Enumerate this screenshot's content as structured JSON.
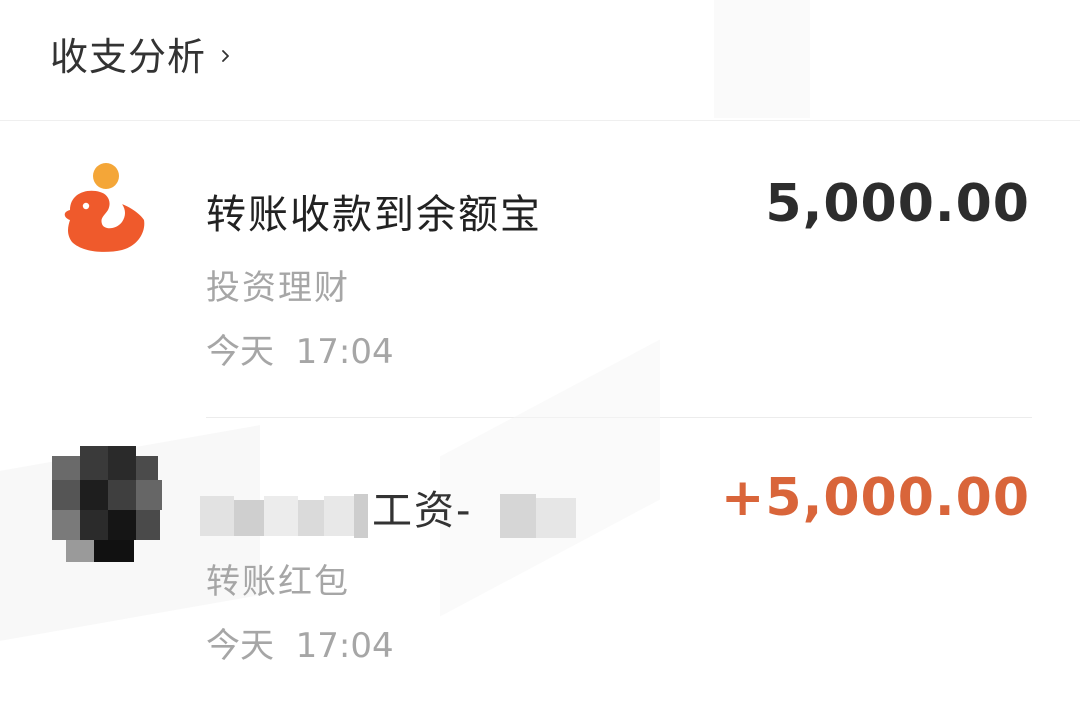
{
  "header": {
    "title": "收支分析",
    "chevron_icon": "chevron-right-icon"
  },
  "transactions": [
    {
      "icon": "yuebao-fish-icon",
      "name": "转账收款到余额宝",
      "amount": "5,000.00",
      "amount_color": "#2d2d2d",
      "category": "投资理财",
      "time": "今天  17:04"
    },
    {
      "icon": "avatar-pixelated",
      "name_visible_part": "工资-",
      "amount": "+5,000.00",
      "amount_color": "#d9653a",
      "category": "转账红包",
      "time": "今天  17:04"
    }
  ],
  "colors": {
    "income_accent": "#d9653a",
    "icon_orange": "#ef5a2c",
    "icon_sun": "#f4a638",
    "secondary_text": "#a6a6a6"
  }
}
